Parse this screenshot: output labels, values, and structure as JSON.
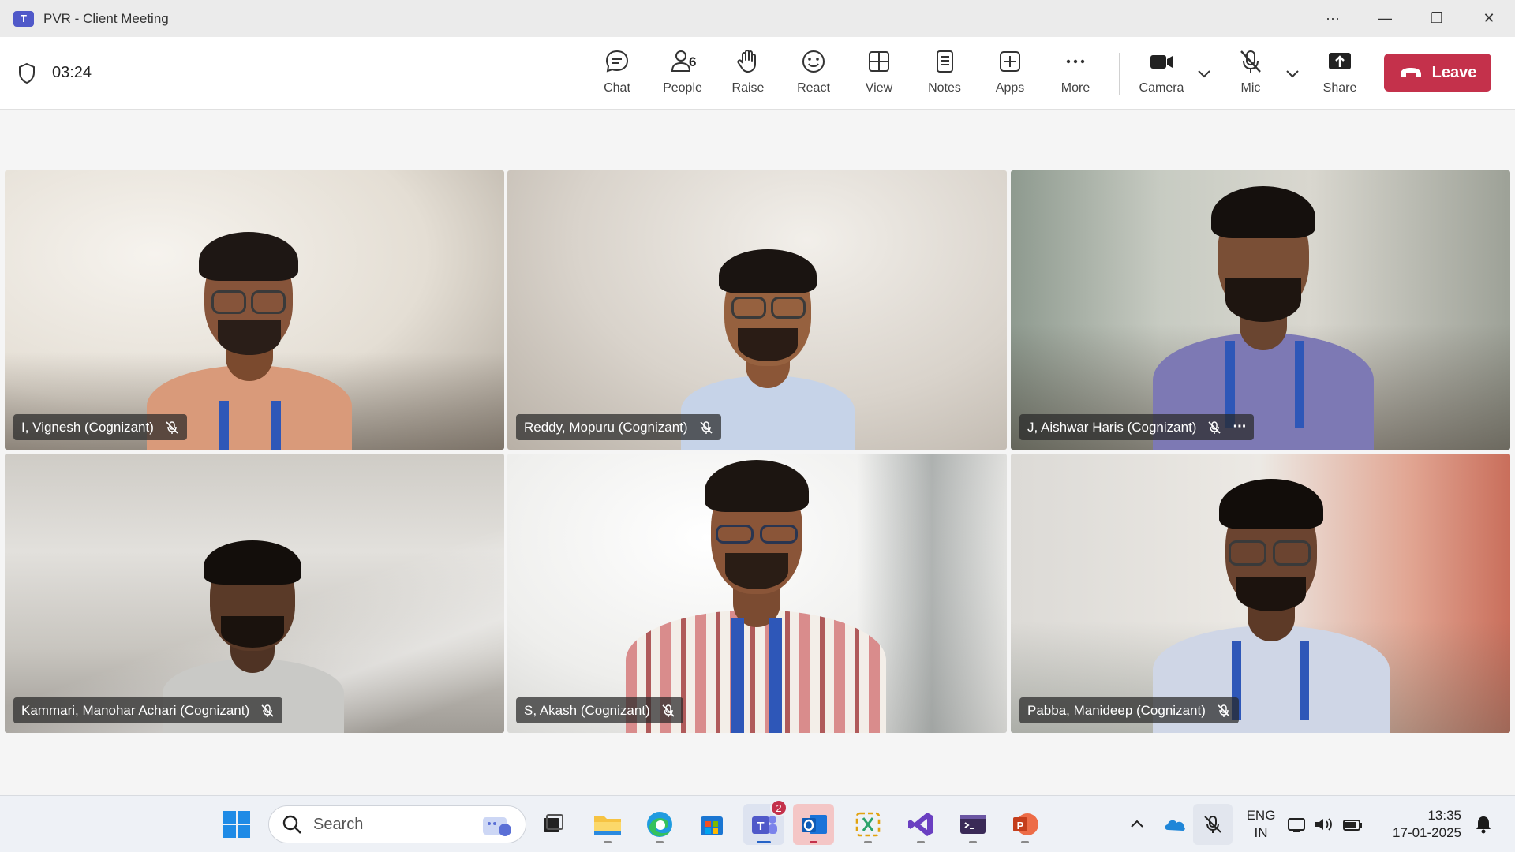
{
  "window": {
    "title": "PVR - Client Meeting",
    "app_icon_glyph": "T"
  },
  "meeting": {
    "timer": "03:24",
    "toolbar": {
      "chat": "Chat",
      "people": "People",
      "people_count": "6",
      "raise": "Raise",
      "react": "React",
      "view": "View",
      "notes": "Notes",
      "apps": "Apps",
      "more": "More",
      "camera": "Camera",
      "mic": "Mic",
      "share": "Share",
      "leave": "Leave"
    },
    "participants": [
      {
        "name": "I, Vignesh (Cognizant)",
        "muted": true
      },
      {
        "name": "Reddy, Mopuru (Cognizant)",
        "muted": true
      },
      {
        "name": "J, Aishwar Haris (Cognizant)",
        "muted": true,
        "more_menu": "···"
      },
      {
        "name": "Kammari, Manohar Achari (Cognizant)",
        "muted": true
      },
      {
        "name": "S, Akash (Cognizant)",
        "muted": true
      },
      {
        "name": "Pabba, Manideep (Cognizant)",
        "muted": true
      }
    ]
  },
  "taskbar": {
    "search_placeholder": "Search",
    "teams_badge": "2",
    "language": {
      "line1": "ENG",
      "line2": "IN"
    },
    "clock": {
      "time": "13:35",
      "date": "17-01-2025"
    }
  },
  "colors": {
    "leave": "#c4314b",
    "teams": "#5059c9",
    "accent": "#2e57b8"
  }
}
